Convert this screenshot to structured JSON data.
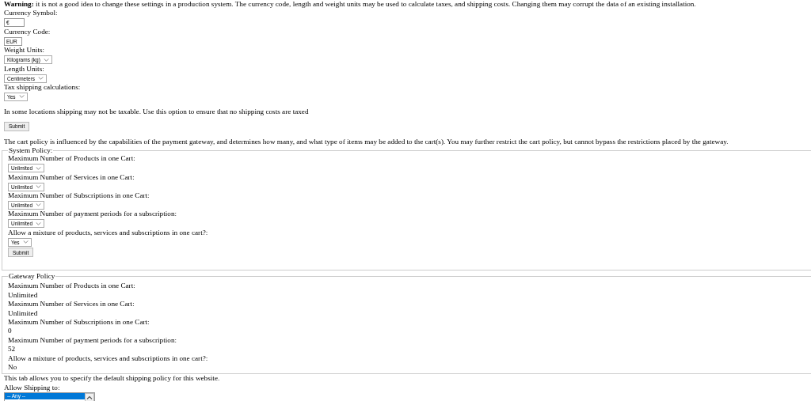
{
  "warning": "**Warning:** it is not a good idea to change these settings in a production system. The currency code, length and weight units may be used to calculate taxes, and shipping costs. Changing them may corrupt the data of an existing installation.",
  "settings_form": {
    "fields": [
      {
        "kind": "text",
        "label": "Currency Symbol:",
        "value": "€"
      },
      {
        "kind": "text",
        "label": "Currency Code:",
        "value": "EUR"
      },
      {
        "kind": "select",
        "label": "Weight Units:",
        "value": "Kilograms (kg)"
      },
      {
        "kind": "select",
        "label": "Length Units:",
        "value": "Centimeters"
      },
      {
        "kind": "select",
        "label": "Tax shipping calculations:",
        "value": "Yes"
      }
    ],
    "help": "In some locations shipping may not be taxable. Use this option to ensure that no shipping costs are taxed",
    "submit": "Submit"
  },
  "cart_intro": "The cart policy is influenced by the capabilities of the payment gateway, and determines how many, and what type of items may be added to the cart(s). You may further restrict the cart policy, but cannot bypass the restrictions placed by the gateway.",
  "system_policy": {
    "legend": "System Policy:",
    "fields": [
      {
        "label": "Maximum Number of Products in one Cart:",
        "value": "Unlimited"
      },
      {
        "label": "Maximum Number of Services in one Cart:",
        "value": "Unlimited"
      },
      {
        "label": "Maximum Number of Subscriptions in one Cart:",
        "value": "Unlimited"
      },
      {
        "label": "Maximum Number of payment periods for a subscription:",
        "value": "Unlimited"
      },
      {
        "label": "Allow a mixture of products, services and subscriptions in one cart?:",
        "value": "Yes"
      }
    ],
    "submit": "Submit"
  },
  "gateway_policy": {
    "legend": "Gateway Policy",
    "fields": [
      {
        "label": "Maximum Number of Products in one Cart:",
        "value": "Unlimited"
      },
      {
        "label": "Maximum Number of Services in one Cart:",
        "value": "Unlimited"
      },
      {
        "label": "Maximum Number of Subscriptions in one Cart:",
        "value": "0"
      },
      {
        "label": "Maximum Number of payment periods for a subscription:",
        "value": "52"
      },
      {
        "label": "Allow a mixture of products, services and subscriptions in one cart?:",
        "value": "No"
      }
    ]
  },
  "shipping_intro": "This tab allows you to specify the default shipping policy for this website.",
  "allow_shipping": {
    "label": "Allow Shipping to:",
    "options": [
      {
        "label": "-- Any --",
        "selected": true
      }
    ]
  }
}
